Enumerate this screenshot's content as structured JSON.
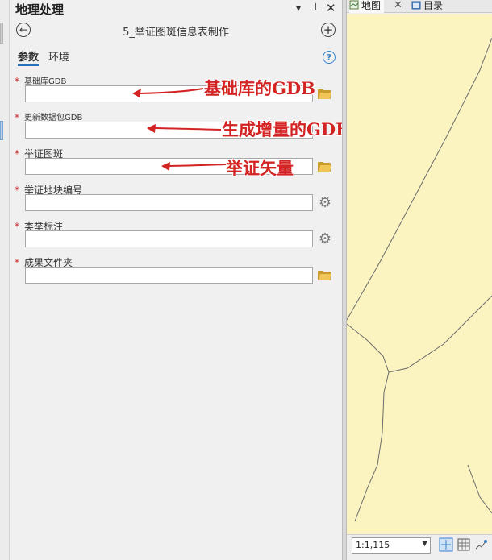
{
  "pane": {
    "title": "地理处理",
    "tool_name": "5_举证图斑信息表制作",
    "dropdown_glyph": "▾",
    "pin_glyph": "⊥",
    "close_glyph": "✕",
    "back_glyph": "←",
    "add_glyph": "+",
    "help_glyph": "?"
  },
  "tabs": {
    "parameters": "参数",
    "environments": "环境"
  },
  "params": [
    {
      "label": "基础库GDB",
      "value": "",
      "required_mark": "*"
    },
    {
      "label": "更新数据包GDB",
      "value": "",
      "required_mark": "*"
    },
    {
      "label": "举证图斑",
      "value": "",
      "required_mark": "*"
    },
    {
      "label": "举证地块编号",
      "value": "",
      "required_mark": "*"
    },
    {
      "label": "类举标注",
      "value": "",
      "required_mark": "*"
    },
    {
      "label": "成果文件夹",
      "value": "",
      "required_mark": "*"
    }
  ],
  "annotations": {
    "base_gdb": "基础库的GDB",
    "incremental_gdb": "生成增量的GDB",
    "evidence_vector": "举证矢量",
    "color": "#d32323"
  },
  "map": {
    "tab_map": "地图",
    "tab_catalog": "目录",
    "tab_close": "✕",
    "scale": "1:1,115",
    "fill_color": "#fbf4c0"
  },
  "icons": {
    "folder": "folder-icon",
    "gear": "gear-icon",
    "gear_glyph": "⚙"
  }
}
